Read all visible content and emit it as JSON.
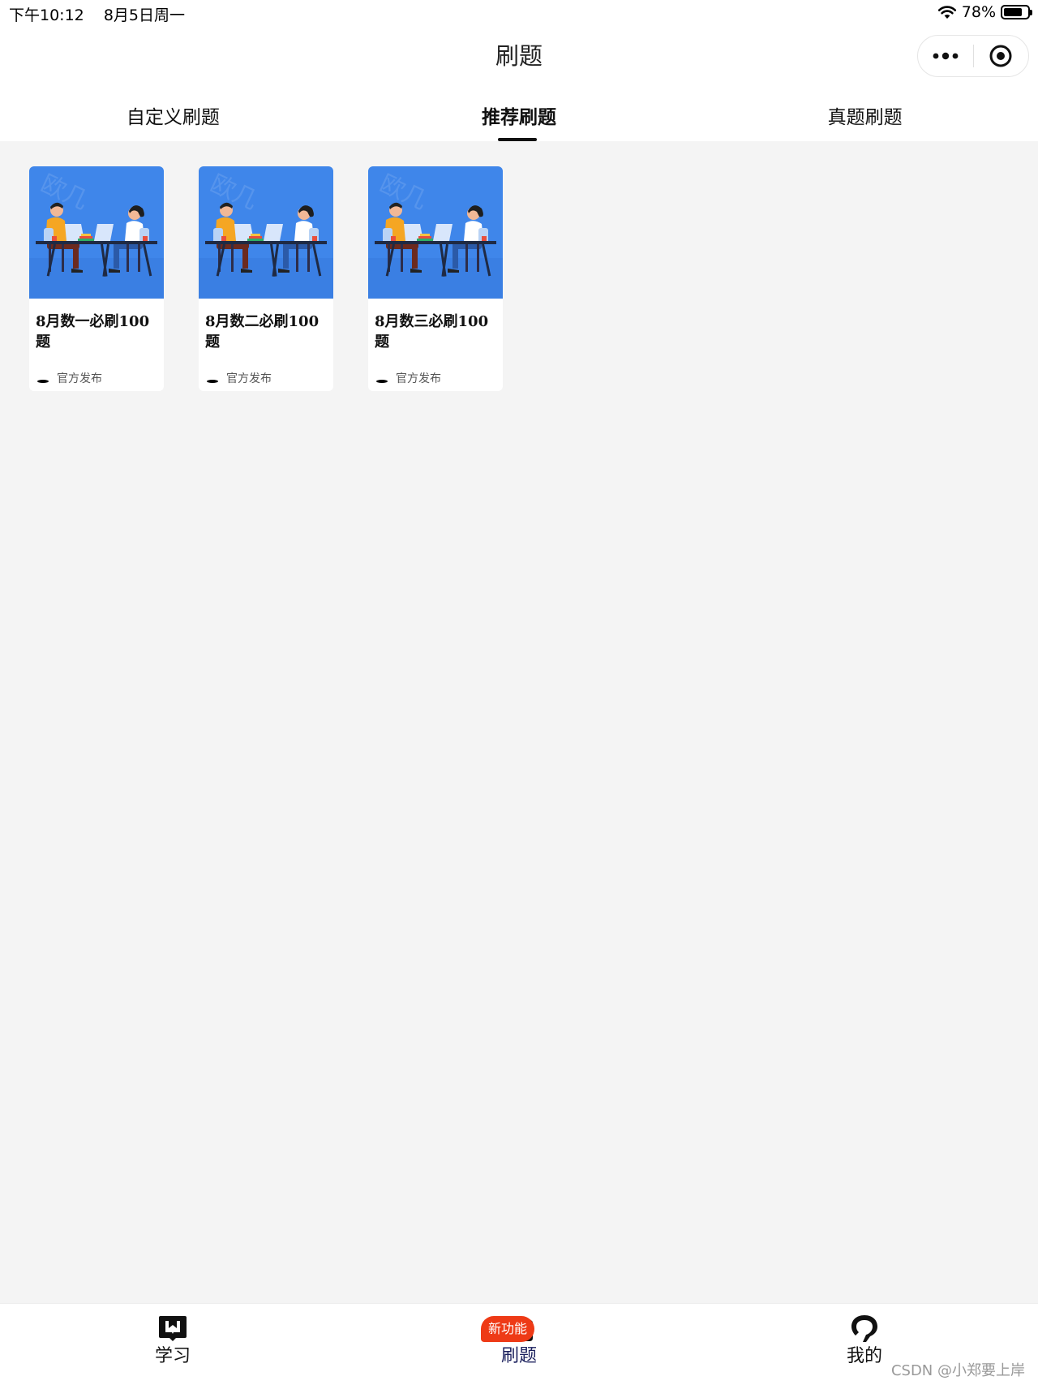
{
  "status_bar": {
    "time": "下午10:12",
    "date": "8月5日周一",
    "battery_text": "78%",
    "battery_level": 0.78
  },
  "header": {
    "title": "刷题"
  },
  "tabs": [
    {
      "label": "自定义刷题",
      "active": false
    },
    {
      "label": "推荐刷题",
      "active": true
    },
    {
      "label": "真题刷题",
      "active": false
    }
  ],
  "cards": [
    {
      "title": "8月数一必刷100题",
      "publisher": "官方发布"
    },
    {
      "title": "8月数二必刷100题",
      "publisher": "官方发布"
    },
    {
      "title": "8月数三必刷100题",
      "publisher": "官方发布"
    }
  ],
  "bottom_nav": {
    "items": [
      {
        "label": "学习",
        "icon": "book-icon"
      },
      {
        "label": "刷题",
        "icon": "folder-icon",
        "active": true
      },
      {
        "label": "我的",
        "icon": "profile-icon"
      }
    ],
    "badge": "新功能"
  },
  "watermark": "CSDN @小郑要上岸",
  "colors": {
    "cover_blue": "#3f86ea",
    "badge_red": "#ee3a16",
    "active_nav": "#1a1f5c",
    "page_bg": "#f4f4f4"
  }
}
